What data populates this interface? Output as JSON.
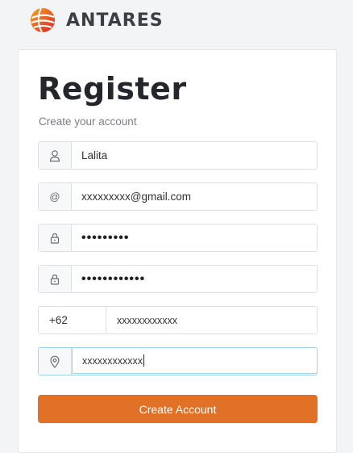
{
  "brand": {
    "name": "ANTARES",
    "logo_icon": "antares-globe-logo",
    "logo_color": "#e2562a"
  },
  "form": {
    "title": "Register",
    "subtitle": "Create your account",
    "fields": [
      {
        "icon": "user-icon",
        "value": "Lalita"
      },
      {
        "icon": "at-icon",
        "icon_text": "@",
        "value": "xxxxxxxxx@gmail.com"
      },
      {
        "icon": "lock-icon",
        "value": "•••••••••"
      },
      {
        "icon": "lock-icon",
        "value": "••••••••••••"
      }
    ],
    "phone": {
      "country_code": "+62",
      "number": "xxxxxxxxxxxx"
    },
    "location": {
      "icon": "location-pin-icon",
      "value": "xxxxxxxxxxxx"
    },
    "submit_label": "Create Account"
  },
  "colors": {
    "accent": "#e07126",
    "focus_border": "#9fd3ec",
    "page_bg": "#f3f4f6"
  }
}
